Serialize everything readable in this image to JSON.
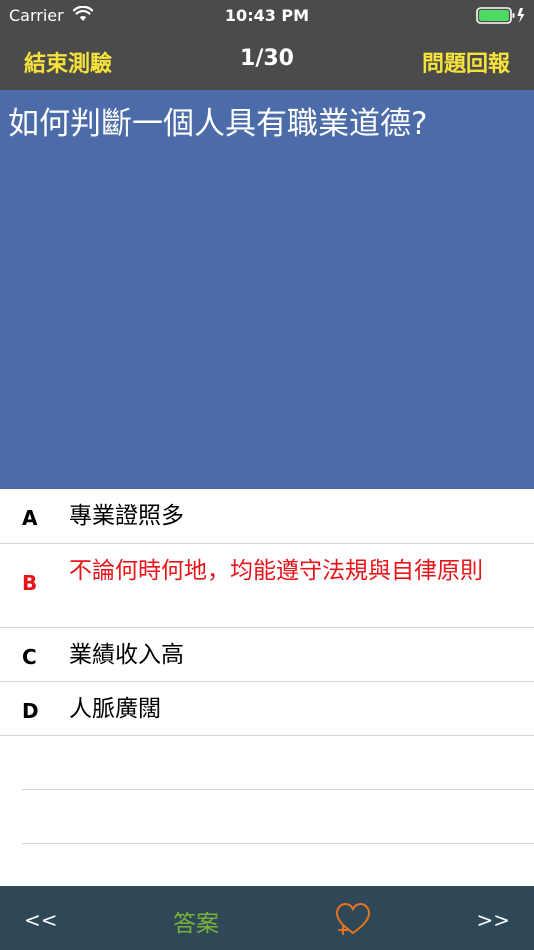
{
  "status_bar": {
    "carrier": "Carrier",
    "time": "10:43 PM"
  },
  "nav": {
    "end_test": "結束測驗",
    "counter": "1/30",
    "report": "問題回報"
  },
  "question": {
    "text": "如何判斷一個人具有職業道德?"
  },
  "options": [
    {
      "letter": "A",
      "text": "專業證照多"
    },
    {
      "letter": "B",
      "text": "不論何時何地，均能遵守法規與自律原則"
    },
    {
      "letter": "C",
      "text": "業績收入高"
    },
    {
      "letter": "D",
      "text": "人脈廣闊"
    }
  ],
  "bottom_bar": {
    "prev": "<<",
    "answer": "答案",
    "favorite_icon": "heart-plus-icon",
    "next": ">>"
  },
  "colors": {
    "nav_background": "#4b4b4b",
    "nav_accent": "#f6e23b",
    "question_background": "#4b6ca8",
    "correct_option": "#e8141a",
    "bottom_bar_background": "#2f4858",
    "answer_button": "#7bb23a",
    "favorite_icon": "#e8731e"
  }
}
